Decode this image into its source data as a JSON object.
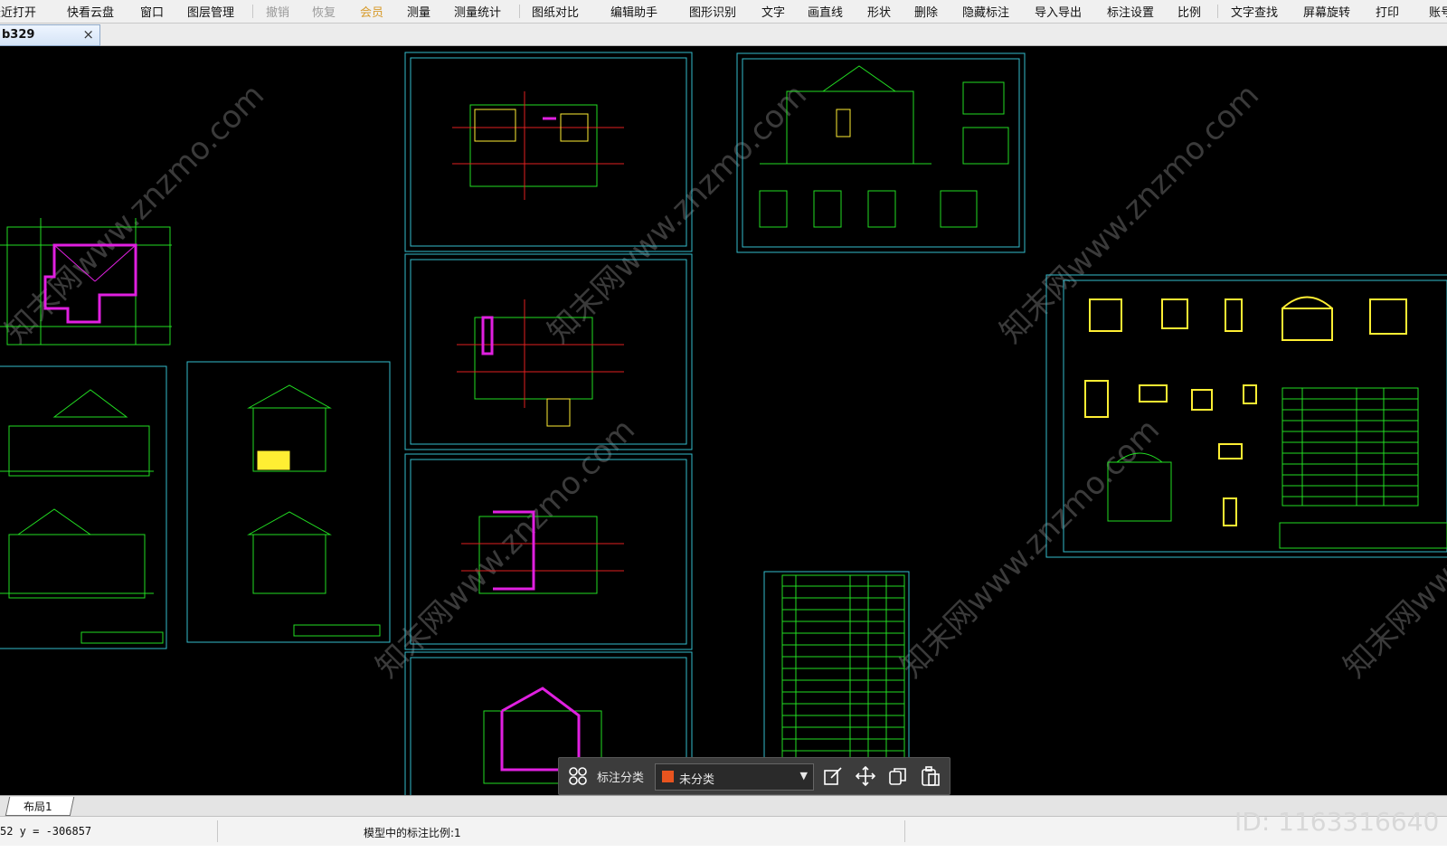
{
  "toolbar": {
    "items": [
      {
        "label": "最近打开",
        "state": "normal"
      },
      {
        "label": "快看云盘",
        "state": "normal"
      },
      {
        "label": "窗口",
        "state": "normal"
      },
      {
        "label": "图层管理",
        "state": "normal"
      },
      {
        "label": "撤销",
        "state": "disabled"
      },
      {
        "label": "恢复",
        "state": "disabled"
      },
      {
        "label": "会员",
        "state": "vip"
      },
      {
        "label": "测量",
        "state": "normal"
      },
      {
        "label": "测量统计",
        "state": "normal"
      },
      {
        "label": "图纸对比",
        "state": "normal"
      },
      {
        "label": "编辑助手",
        "state": "normal"
      },
      {
        "label": "图形识别",
        "state": "normal"
      },
      {
        "label": "文字",
        "state": "normal"
      },
      {
        "label": "画直线",
        "state": "normal"
      },
      {
        "label": "形状",
        "state": "normal"
      },
      {
        "label": "删除",
        "state": "normal"
      },
      {
        "label": "隐藏标注",
        "state": "normal"
      },
      {
        "label": "导入导出",
        "state": "normal"
      },
      {
        "label": "标注设置",
        "state": "normal"
      },
      {
        "label": "比例",
        "state": "normal"
      },
      {
        "label": "文字查找",
        "state": "normal"
      },
      {
        "label": "屏幕旋转",
        "state": "normal"
      },
      {
        "label": "打印",
        "state": "normal"
      },
      {
        "label": "账号",
        "state": "normal"
      }
    ]
  },
  "tab": {
    "label": "b329",
    "close": "×"
  },
  "layout_tab": {
    "label": "布局1"
  },
  "status": {
    "coords": "52 y = -306857",
    "scale_text": "模型中的标注比例:1"
  },
  "float_toolbar": {
    "label": "标注分类",
    "category": "未分类",
    "category_color": "#e8541f",
    "icons": [
      "grid-icon",
      "edit-icon",
      "move-icon",
      "copy-icon",
      "paste-icon"
    ]
  },
  "watermark": {
    "brand": "知末",
    "id_text": "ID: 1163316640",
    "diagonal": "知末网www.znzmo.com"
  },
  "colors": {
    "cad_green": "#22dd22",
    "cad_magenta": "#e020e0",
    "cad_yellow": "#ffee33",
    "cad_red": "#e02020",
    "frame_cyan": "#33bbcc",
    "canvas": "#000000"
  }
}
